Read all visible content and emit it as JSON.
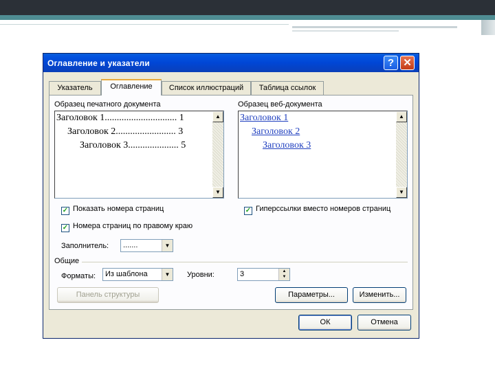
{
  "dialog": {
    "title": "Оглавление и указатели",
    "help_glyph": "?",
    "close_glyph": "✕"
  },
  "tabs": [
    {
      "label": "Указатель",
      "active": false
    },
    {
      "label": "Оглавление",
      "active": true
    },
    {
      "label": "Список иллюстраций",
      "active": false
    },
    {
      "label": "Таблица ссылок",
      "active": false
    }
  ],
  "print_preview": {
    "label": "Образец печатного документа",
    "lines": [
      "Заголовок 1.............................. 1",
      "Заголовок 2......................... 3",
      "Заголовок 3..................... 5"
    ]
  },
  "web_preview": {
    "label": "Образец веб-документа",
    "lines": [
      "Заголовок 1",
      "Заголовок 2",
      "Заголовок 3"
    ]
  },
  "options": {
    "show_page_numbers": "Показать номера страниц",
    "right_align_numbers": "Номера страниц по правому краю",
    "hyperlinks_instead": "Гиперссылки вместо номеров страниц",
    "check_glyph": "✓",
    "tab_leader_label": "Заполнитель:",
    "tab_leader_value": "......."
  },
  "general": {
    "group_label": "Общие",
    "formats_label": "Форматы:",
    "formats_value": "Из шаблона",
    "levels_label": "Уровни:",
    "levels_value": "3"
  },
  "buttons": {
    "outline_toolbar": "Панель структуры",
    "options": "Параметры...",
    "modify": "Изменить...",
    "ok": "ОК",
    "cancel": "Отмена"
  },
  "icons": {
    "scroll_up": "▲",
    "scroll_down": "▼",
    "dropdown": "▼"
  }
}
